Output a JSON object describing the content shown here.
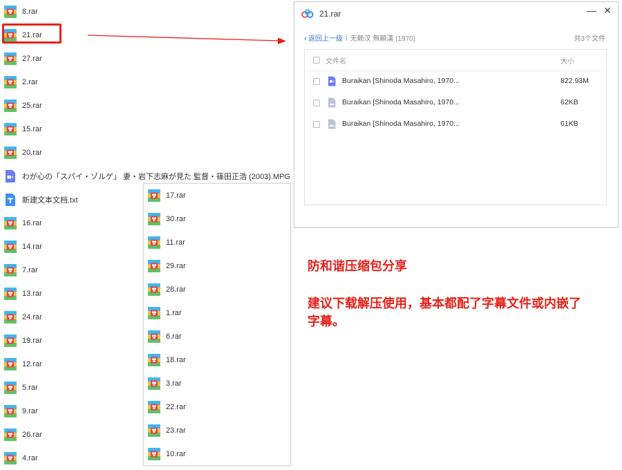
{
  "left_files": [
    "8.rar",
    "21.rar",
    "27.rar",
    "2.rar",
    "25.rar",
    "15.rar",
    "20.rar",
    "わが心の「スパイ・ゾルゲ」 妻・岩下志麻が見た 監督・篠田正浩 (2003).MPG",
    "新建文本文档.txt",
    "16.rar",
    "14.rar",
    "7.rar",
    "13.rar",
    "24.rar",
    "19.rar",
    "12.rar",
    "5.rar",
    "9.rar",
    "26.rar",
    "4.rar"
  ],
  "left_types": [
    "rar",
    "rar",
    "rar",
    "rar",
    "rar",
    "rar",
    "rar",
    "video",
    "txt",
    "rar",
    "rar",
    "rar",
    "rar",
    "rar",
    "rar",
    "rar",
    "rar",
    "rar",
    "rar",
    "rar"
  ],
  "popup_files": [
    "17.rar",
    "30.rar",
    "11.rar",
    "29.rar",
    "28.rar",
    "1.rar",
    "6.rar",
    "18.rar",
    "3.rar",
    "22.rar",
    "23.rar",
    "10.rar"
  ],
  "dialog": {
    "title": "21.rar",
    "minimize": "—",
    "close": "✕",
    "back_label": "返回上一级",
    "path": "无赖汉 無頼漢 (1970)",
    "count": "共3个文件",
    "col_name": "文件名",
    "col_size": "大小",
    "files": [
      {
        "name": "Buraikan [Shinoda Masahiro, 1970...",
        "size": "822.93M",
        "type": "video"
      },
      {
        "name": "Buraikan [Shinoda Masahiro, 1970...",
        "size": "62KB",
        "type": "image"
      },
      {
        "name": "Buraikan [Shinoda Masahiro, 1970...",
        "size": "61KB",
        "type": "image"
      }
    ]
  },
  "note": {
    "line1": "防和谐压缩包分享",
    "line2": "建议下载解压使用，基本都配了字幕文件或内嵌了",
    "line3": "字幕。"
  },
  "colors": {
    "accent_red": "#e5221b",
    "link_blue": "#3a7bd5"
  }
}
